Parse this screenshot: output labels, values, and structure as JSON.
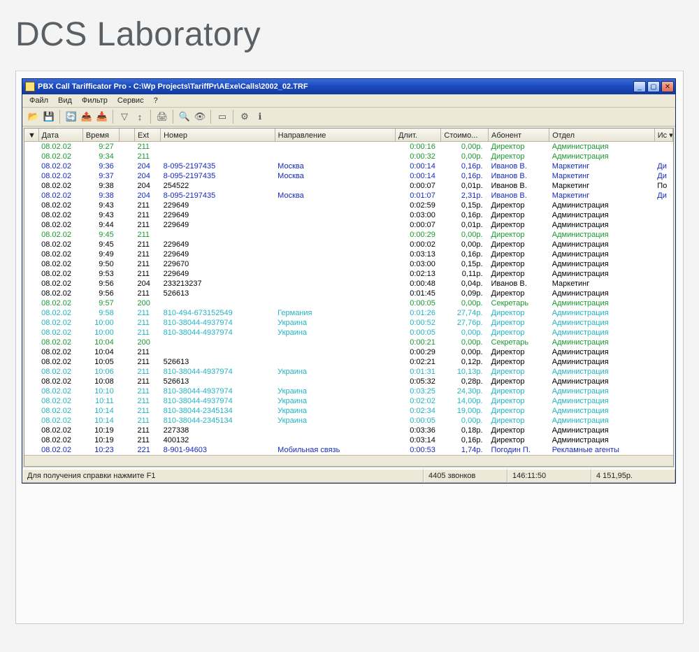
{
  "page": {
    "heading": "DCS Laboratory"
  },
  "window": {
    "title": "PBX Call Tarifficator Pro - C:\\Wp Projects\\TariffPr\\AExe\\Calls\\2002_02.TRF",
    "menu": [
      "Файл",
      "Вид",
      "Фильтр",
      "Сервис",
      "?"
    ],
    "toolbar_icons": [
      {
        "name": "open-icon",
        "glyph": "📂"
      },
      {
        "name": "save-icon",
        "glyph": "💾"
      },
      {
        "name": "refresh-icon",
        "glyph": "🔄"
      },
      {
        "name": "export-icon",
        "glyph": "📤"
      },
      {
        "name": "import-icon",
        "glyph": "📥"
      },
      {
        "name": "filter-icon",
        "glyph": "▽"
      },
      {
        "name": "sort-icon",
        "glyph": "↕"
      },
      {
        "name": "print-icon",
        "glyph": "🖨"
      },
      {
        "name": "find-icon",
        "glyph": "🔍"
      },
      {
        "name": "find-next-icon",
        "glyph": "👁"
      },
      {
        "name": "columns-icon",
        "glyph": "▭"
      },
      {
        "name": "options-icon",
        "glyph": "⚙"
      },
      {
        "name": "help-icon",
        "glyph": "ℹ"
      }
    ],
    "columns": [
      "▼",
      "Дата",
      "Время",
      "",
      "Ext",
      "Номер",
      "Направление",
      "Длит.",
      "Стоимо...",
      "Абонент",
      "Отдел",
      "Ис ▾"
    ],
    "rows": [
      {
        "cls": "c-green",
        "d": "08.02.02",
        "t": "9:27",
        "ext": "211",
        "num": "",
        "dir": "",
        "dur": "0:00:16",
        "cost": "0,00р.",
        "ab": "Директор",
        "dep": "Администрация",
        "x": ""
      },
      {
        "cls": "c-green",
        "d": "08.02.02",
        "t": "9:34",
        "ext": "211",
        "num": "",
        "dir": "",
        "dur": "0:00:32",
        "cost": "0,00р.",
        "ab": "Директор",
        "dep": "Администрация",
        "x": ""
      },
      {
        "cls": "c-blue",
        "d": "08.02.02",
        "t": "9:36",
        "ext": "204",
        "num": "8-095-2197435",
        "dir": "Москва",
        "dur": "0:00:14",
        "cost": "0,16р.",
        "ab": "Иванов В.",
        "dep": "Маркетинг",
        "x": "Ди"
      },
      {
        "cls": "c-blue",
        "d": "08.02.02",
        "t": "9:37",
        "ext": "204",
        "num": "8-095-2197435",
        "dir": "Москва",
        "dur": "0:00:14",
        "cost": "0,16р.",
        "ab": "Иванов В.",
        "dep": "Маркетинг",
        "x": "Ди"
      },
      {
        "cls": "c-black",
        "d": "08.02.02",
        "t": "9:38",
        "ext": "204",
        "num": "254522",
        "dir": "",
        "dur": "0:00:07",
        "cost": "0,01р.",
        "ab": "Иванов В.",
        "dep": "Маркетинг",
        "x": "По"
      },
      {
        "cls": "c-blue",
        "d": "08.02.02",
        "t": "9:38",
        "ext": "204",
        "num": "8-095-2197435",
        "dir": "Москва",
        "dur": "0:01:07",
        "cost": "2,31р.",
        "ab": "Иванов В.",
        "dep": "Маркетинг",
        "x": "Ди"
      },
      {
        "cls": "c-black",
        "d": "08.02.02",
        "t": "9:43",
        "ext": "211",
        "num": "229649",
        "dir": "",
        "dur": "0:02:59",
        "cost": "0,15р.",
        "ab": "Директор",
        "dep": "Администрация",
        "x": ""
      },
      {
        "cls": "c-black",
        "d": "08.02.02",
        "t": "9:43",
        "ext": "211",
        "num": "229649",
        "dir": "",
        "dur": "0:03:00",
        "cost": "0,16р.",
        "ab": "Директор",
        "dep": "Администрация",
        "x": ""
      },
      {
        "cls": "c-black",
        "d": "08.02.02",
        "t": "9:44",
        "ext": "211",
        "num": "229649",
        "dir": "",
        "dur": "0:00:07",
        "cost": "0,01р.",
        "ab": "Директор",
        "dep": "Администрация",
        "x": ""
      },
      {
        "cls": "c-green",
        "d": "08.02.02",
        "t": "9:45",
        "ext": "211",
        "num": "",
        "dir": "",
        "dur": "0:00:29",
        "cost": "0,00р.",
        "ab": "Директор",
        "dep": "Администрация",
        "x": ""
      },
      {
        "cls": "c-black",
        "d": "08.02.02",
        "t": "9:45",
        "ext": "211",
        "num": "229649",
        "dir": "",
        "dur": "0:00:02",
        "cost": "0,00р.",
        "ab": "Директор",
        "dep": "Администрация",
        "x": ""
      },
      {
        "cls": "c-black",
        "d": "08.02.02",
        "t": "9:49",
        "ext": "211",
        "num": "229649",
        "dir": "",
        "dur": "0:03:13",
        "cost": "0,16р.",
        "ab": "Директор",
        "dep": "Администрация",
        "x": ""
      },
      {
        "cls": "c-black",
        "d": "08.02.02",
        "t": "9:50",
        "ext": "211",
        "num": "229670",
        "dir": "",
        "dur": "0:03:00",
        "cost": "0,15р.",
        "ab": "Директор",
        "dep": "Администрация",
        "x": ""
      },
      {
        "cls": "c-black",
        "d": "08.02.02",
        "t": "9:53",
        "ext": "211",
        "num": "229649",
        "dir": "",
        "dur": "0:02:13",
        "cost": "0,11р.",
        "ab": "Директор",
        "dep": "Администрация",
        "x": ""
      },
      {
        "cls": "c-black",
        "d": "08.02.02",
        "t": "9:56",
        "ext": "204",
        "num": "233213237",
        "dir": "",
        "dur": "0:00:48",
        "cost": "0,04р.",
        "ab": "Иванов В.",
        "dep": "Маркетинг",
        "x": ""
      },
      {
        "cls": "c-black",
        "d": "08.02.02",
        "t": "9:56",
        "ext": "211",
        "num": "526613",
        "dir": "",
        "dur": "0:01:45",
        "cost": "0,09р.",
        "ab": "Директор",
        "dep": "Администрация",
        "x": ""
      },
      {
        "cls": "c-green",
        "d": "08.02.02",
        "t": "9:57",
        "ext": "200",
        "num": "",
        "dir": "",
        "dur": "0:00:05",
        "cost": "0,00р.",
        "ab": "Секретарь",
        "dep": "Администрация",
        "x": ""
      },
      {
        "cls": "c-teal",
        "d": "08.02.02",
        "t": "9:58",
        "ext": "211",
        "num": "810-494-673152549",
        "dir": "Германия",
        "dur": "0:01:26",
        "cost": "27,74р.",
        "ab": "Директор",
        "dep": "Администрация",
        "x": ""
      },
      {
        "cls": "c-teal",
        "d": "08.02.02",
        "t": "10:00",
        "ext": "211",
        "num": "810-38044-4937974",
        "dir": "Украина",
        "dur": "0:00:52",
        "cost": "27,76р.",
        "ab": "Директор",
        "dep": "Администрация",
        "x": ""
      },
      {
        "cls": "c-teal",
        "d": "08.02.02",
        "t": "10:00",
        "ext": "211",
        "num": "810-38044-4937974",
        "dir": "Украина",
        "dur": "0:00:05",
        "cost": "0,00р.",
        "ab": "Директор",
        "dep": "Администрация",
        "x": ""
      },
      {
        "cls": "c-green",
        "d": "08.02.02",
        "t": "10:04",
        "ext": "200",
        "num": "",
        "dir": "",
        "dur": "0:00:21",
        "cost": "0,00р.",
        "ab": "Секретарь",
        "dep": "Администрация",
        "x": ""
      },
      {
        "cls": "c-black",
        "d": "08.02.02",
        "t": "10:04",
        "ext": "211",
        "num": "",
        "dir": "",
        "dur": "0:00:29",
        "cost": "0,00р.",
        "ab": "Директор",
        "dep": "Администрация",
        "x": ""
      },
      {
        "cls": "c-black",
        "d": "08.02.02",
        "t": "10:05",
        "ext": "211",
        "num": "526613",
        "dir": "",
        "dur": "0:02:21",
        "cost": "0,12р.",
        "ab": "Директор",
        "dep": "Администрация",
        "x": ""
      },
      {
        "cls": "c-teal",
        "d": "08.02.02",
        "t": "10:06",
        "ext": "211",
        "num": "810-38044-4937974",
        "dir": "Украина",
        "dur": "0:01:31",
        "cost": "10,13р.",
        "ab": "Директор",
        "dep": "Администрация",
        "x": ""
      },
      {
        "cls": "c-black",
        "d": "08.02.02",
        "t": "10:08",
        "ext": "211",
        "num": "526613",
        "dir": "",
        "dur": "0:05:32",
        "cost": "0,28р.",
        "ab": "Директор",
        "dep": "Администрация",
        "x": ""
      },
      {
        "cls": "c-teal",
        "d": "08.02.02",
        "t": "10:10",
        "ext": "211",
        "num": "810-38044-4937974",
        "dir": "Украина",
        "dur": "0:03:25",
        "cost": "24,30р.",
        "ab": "Директор",
        "dep": "Администрация",
        "x": ""
      },
      {
        "cls": "c-teal",
        "d": "08.02.02",
        "t": "10:11",
        "ext": "211",
        "num": "810-38044-4937974",
        "dir": "Украина",
        "dur": "0:02:02",
        "cost": "14,00р.",
        "ab": "Директор",
        "dep": "Администрация",
        "x": ""
      },
      {
        "cls": "c-teal",
        "d": "08.02.02",
        "t": "10:14",
        "ext": "211",
        "num": "810-38044-2345134",
        "dir": "Украина",
        "dur": "0:02:34",
        "cost": "19,00р.",
        "ab": "Директор",
        "dep": "Администрация",
        "x": ""
      },
      {
        "cls": "c-teal",
        "d": "08.02.02",
        "t": "10:14",
        "ext": "211",
        "num": "810-38044-2345134",
        "dir": "Украина",
        "dur": "0:00:05",
        "cost": "0,00р.",
        "ab": "Директор",
        "dep": "Администрация",
        "x": ""
      },
      {
        "cls": "c-black",
        "d": "08.02.02",
        "t": "10:19",
        "ext": "211",
        "num": "227338",
        "dir": "",
        "dur": "0:03:36",
        "cost": "0,18р.",
        "ab": "Директор",
        "dep": "Администрация",
        "x": ""
      },
      {
        "cls": "c-black",
        "d": "08.02.02",
        "t": "10:19",
        "ext": "211",
        "num": "400132",
        "dir": "",
        "dur": "0:03:14",
        "cost": "0,16р.",
        "ab": "Директор",
        "dep": "Администрация",
        "x": ""
      },
      {
        "cls": "c-blue",
        "d": "08.02.02",
        "t": "10:23",
        "ext": "221",
        "num": "8-901-94603",
        "dir": "Мобильная связь",
        "dur": "0:00:53",
        "cost": "1,74р.",
        "ab": "Погодин П.",
        "dep": "Рекламные агенты",
        "x": ""
      }
    ],
    "status": {
      "hint": "Для получения справки нажмите F1",
      "calls": "4405 звонков",
      "time": "146:11:50",
      "sum": "4 151,95р."
    }
  }
}
